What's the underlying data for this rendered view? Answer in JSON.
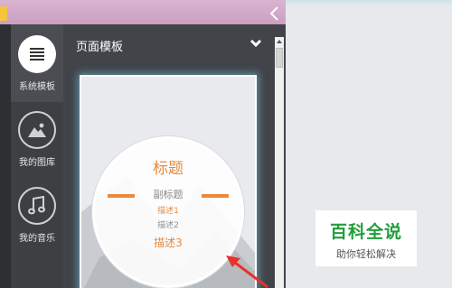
{
  "sidebar": {
    "items": [
      {
        "label": "系统模板",
        "icon": "list-icon",
        "active": true
      },
      {
        "label": "我的图库",
        "icon": "image-icon",
        "active": false
      },
      {
        "label": "我的音乐",
        "icon": "music-note-icon",
        "active": false
      }
    ]
  },
  "panel": {
    "title": "页面模板"
  },
  "template": {
    "title": "标题",
    "subtitle": "副标题",
    "desc1": "描述1",
    "desc2": "描述2",
    "desc3": "描述3"
  },
  "watermark": {
    "title": "百科全说",
    "subtitle": "助你轻松解决"
  },
  "colors": {
    "accent": "#e88a3c",
    "sidebar_bg": "#3d3f43",
    "panel_bg": "#414449",
    "watermark_green": "#1f9e3a",
    "arrow_red": "#e8312a"
  }
}
